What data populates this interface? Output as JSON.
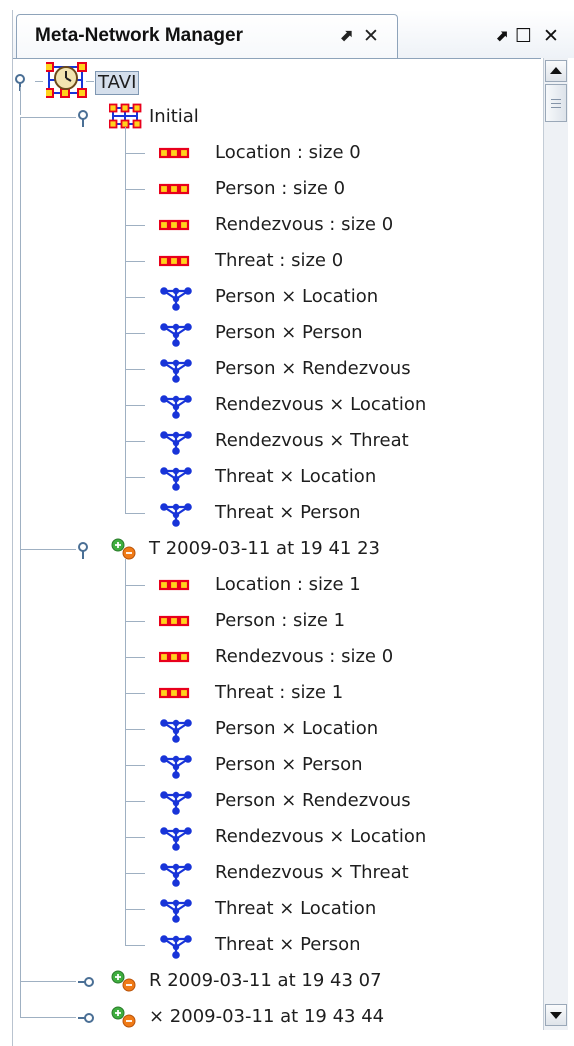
{
  "panel": {
    "title": "Meta-Network Manager",
    "pin_icon": "pin-icon",
    "close_icon": "close-icon",
    "window_controls": [
      "restore-icon",
      "maximize-icon",
      "close-icon"
    ]
  },
  "tree": {
    "root": {
      "label": "TAVI",
      "icon": "metanetwork-clock-icon",
      "state": "expanded"
    },
    "groups": [
      {
        "label": "Initial",
        "icon": "metanetwork-icon",
        "state": "expanded",
        "nodesets": [
          "Location : size 0",
          "Person : size 0",
          "Rendezvous : size 0",
          "Threat : size 0"
        ],
        "networks": [
          "Person × Location",
          "Person × Person",
          "Person × Rendezvous",
          "Rendezvous × Location",
          "Rendezvous × Threat",
          "Threat × Location",
          "Threat × Person"
        ]
      },
      {
        "label": "T 2009-03-11 at 19 41 23",
        "icon": "addremove-icon",
        "state": "expanded",
        "nodesets": [
          "Location : size 1",
          "Person : size 1",
          "Rendezvous : size 0",
          "Threat : size 1"
        ],
        "networks": [
          "Person × Location",
          "Person × Person",
          "Person × Rendezvous",
          "Rendezvous × Location",
          "Rendezvous × Threat",
          "Threat × Location",
          "Threat × Person"
        ]
      },
      {
        "label": "R 2009-03-11 at 19 43 07",
        "icon": "addremove-icon",
        "state": "collapsed"
      },
      {
        "label": "× 2009-03-11 at 19 43 44",
        "icon": "addremove-icon",
        "state": "collapsed"
      }
    ]
  },
  "colors": {
    "nodeset_red": "#e8001c",
    "nodeset_yellow": "#ffd21c",
    "network_blue": "#1834d8",
    "tree_line": "#9fb0c2",
    "selection": "#d5dfec"
  }
}
